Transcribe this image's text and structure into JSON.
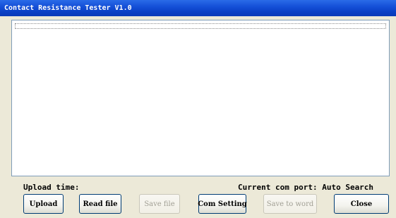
{
  "window": {
    "title": "Contact Resistance Tester V1.0"
  },
  "status": {
    "upload_time_label": "Upload time:",
    "com_port_label": "Current com port: Auto Search"
  },
  "buttons": {
    "upload": {
      "label": "Upload",
      "enabled": true
    },
    "read_file": {
      "label": "Read file",
      "enabled": true
    },
    "save_file": {
      "label": "Save file",
      "enabled": false
    },
    "com_setting": {
      "label": "Com Setting",
      "enabled": true
    },
    "save_to_word": {
      "label": "Save to word",
      "enabled": false
    },
    "close": {
      "label": "Close",
      "enabled": true
    }
  },
  "colors": {
    "titlebar": "#0a3fc4",
    "window_bg": "#ece9d8",
    "button_border": "#003c74",
    "disabled_text": "#a19f94"
  }
}
